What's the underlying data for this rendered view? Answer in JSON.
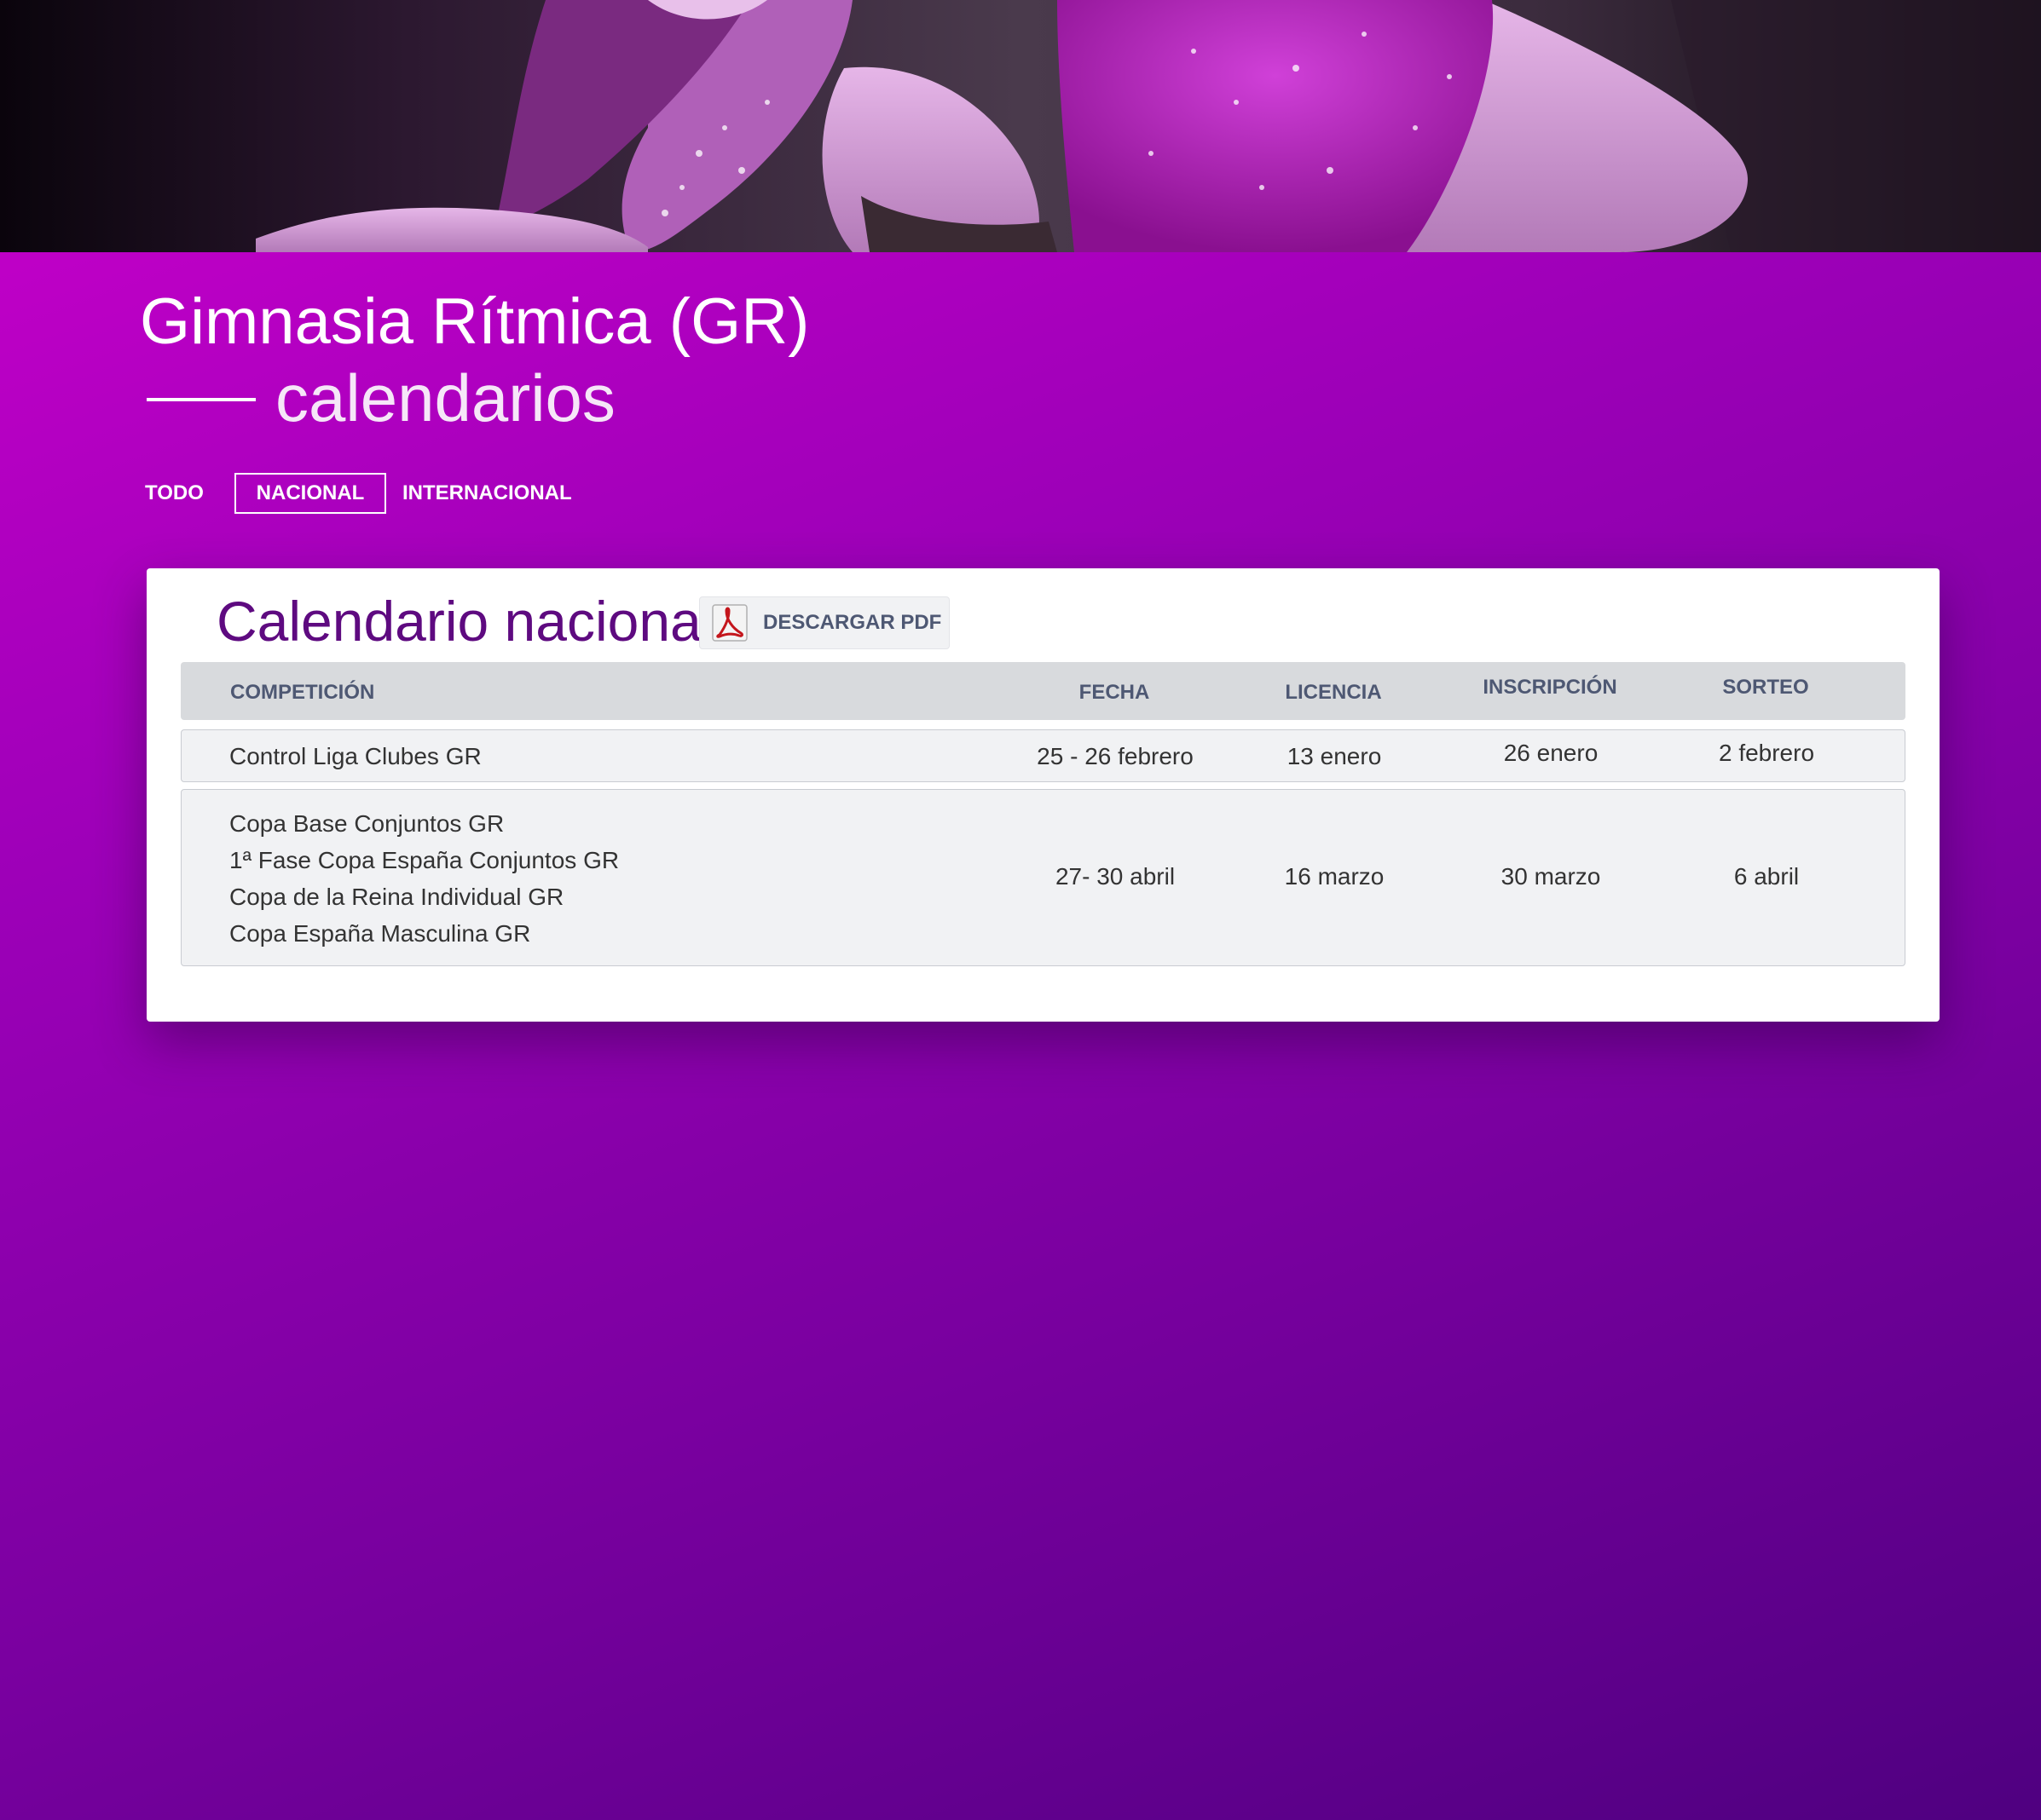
{
  "page": {
    "title": "Gimnasia Rítmica (GR)",
    "subtitle": "calendarios"
  },
  "filters": {
    "all": "TODO",
    "national": "NACIONAL",
    "international": "INTERNACIONAL",
    "active": "NACIONAL"
  },
  "calendar": {
    "title": "Calendario nacional",
    "download_label": "DESCARGAR PDF",
    "download_icon": "pdf-icon",
    "columns": [
      "COMPETICIÓN",
      "FECHA",
      "LICENCIA",
      "INSCRIPCIÓN",
      "SORTEO"
    ],
    "rows": [
      {
        "competitions": [
          "Control Liga Clubes GR"
        ],
        "fecha": "25 - 26 febrero",
        "licencia": "13 enero",
        "inscripcion": "26 enero",
        "sorteo": "2 febrero"
      },
      {
        "competitions": [
          "Copa Base Conjuntos GR",
          "1ª Fase Copa España Conjuntos GR",
          "Copa de la Reina Individual GR",
          "Copa España Masculina GR"
        ],
        "fecha": "27- 30 abril",
        "licencia": "16 marzo",
        "inscripcion": "30 marzo",
        "sorteo": "6 abril"
      }
    ]
  },
  "colors": {
    "background_start": "#cc00cc",
    "background_end": "#4f0080",
    "card_title": "#5e0a80",
    "header_text": "#4e5873",
    "row_background": "#f1f2f4",
    "header_background": "#d8dadd"
  }
}
